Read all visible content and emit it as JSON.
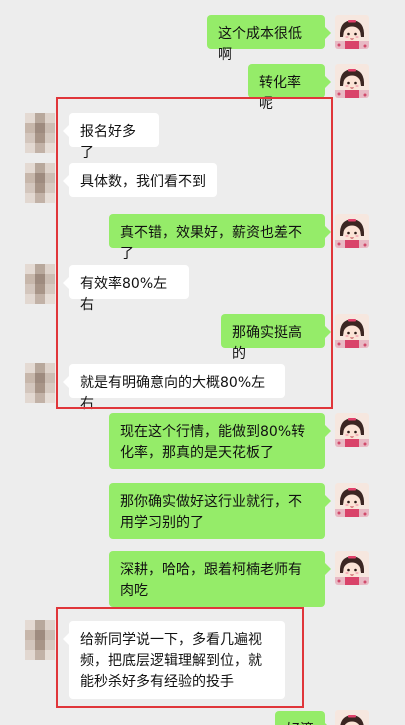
{
  "messages": [
    {
      "side": "out",
      "text": "这个成本很低啊"
    },
    {
      "side": "out",
      "text": "转化率呢"
    },
    {
      "side": "in",
      "text": "报名好多了"
    },
    {
      "side": "in",
      "text": "具体数，我们看不到"
    },
    {
      "side": "out",
      "text": "真不错，效果好，薪资也差不了"
    },
    {
      "side": "in",
      "text": "有效率80%左右"
    },
    {
      "side": "out",
      "text": "那确实挺高的"
    },
    {
      "side": "in",
      "text": "就是有明确意向的大概80%左右"
    },
    {
      "side": "out",
      "text": "现在这个行情，能做到80%转化率，那真的是天花板了"
    },
    {
      "side": "out",
      "text": "那你确实做好这行业就行，不用学习别的了"
    },
    {
      "side": "out",
      "text": "深耕，哈哈，跟着柯楠老师有肉吃"
    },
    {
      "side": "in",
      "text": "给新同学说一下，多看几遍视频，把底层逻辑理解到位，就能秒杀好多有经验的投手"
    },
    {
      "side": "out",
      "text": "好滴"
    }
  ],
  "colors": {
    "background": "#ededed",
    "outgoing_bubble": "#95ec69",
    "incoming_bubble": "#ffffff",
    "highlight_border": "#e0363a"
  },
  "icons": {
    "outgoing_avatar": "cartoon-girl-avatar",
    "incoming_avatar": "blurred-avatar"
  }
}
